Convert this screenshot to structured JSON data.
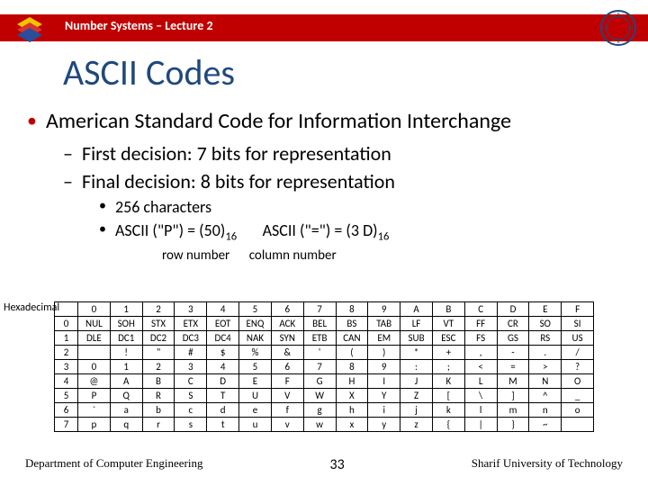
{
  "header": {
    "lecture_title": "Number Systems – Lecture 2"
  },
  "slide": {
    "title": "ASCII Codes"
  },
  "bullets": {
    "b1": "American Standard Code for Information Interchange",
    "b1_1": "First  decision: 7 bits for representation",
    "b1_2": "Final decision: 8 bits for representation",
    "b1_2_1": "256 characters",
    "b1_2_2_a": "ASCII (\"P\") = (50)",
    "b1_2_2_b": "ASCII (\"=\") = (3 D)",
    "sub16": "16",
    "cap_row": "row number",
    "cap_col": "column number"
  },
  "table": {
    "label": "Hexadecimal",
    "col_headers": [
      "0",
      "1",
      "2",
      "3",
      "4",
      "5",
      "6",
      "7",
      "8",
      "9",
      "A",
      "B",
      "C",
      "D",
      "E",
      "F"
    ],
    "row_headers": [
      "0",
      "1",
      "2",
      "3",
      "4",
      "5",
      "6",
      "7"
    ],
    "rows": [
      [
        "NUL",
        "SOH",
        "STX",
        "ETX",
        "EOT",
        "ENQ",
        "ACK",
        "BEL",
        "BS",
        "TAB",
        "LF",
        "VT",
        "FF",
        "CR",
        "SO",
        "SI"
      ],
      [
        "DLE",
        "DC1",
        "DC2",
        "DC3",
        "DC4",
        "NAK",
        "SYN",
        "ETB",
        "CAN",
        "EM",
        "SUB",
        "ESC",
        "FS",
        "GS",
        "RS",
        "US"
      ],
      [
        "",
        "!",
        "\"",
        "#",
        "$",
        "%",
        "&",
        "'",
        "(",
        ")",
        "*",
        "+",
        ",",
        "-",
        ".",
        "/"
      ],
      [
        "0",
        "1",
        "2",
        "3",
        "4",
        "5",
        "6",
        "7",
        "8",
        "9",
        ":",
        ";",
        "<",
        "=",
        ">",
        "?"
      ],
      [
        "@",
        "A",
        "B",
        "C",
        "D",
        "E",
        "F",
        "G",
        "H",
        "I",
        "J",
        "K",
        "L",
        "M",
        "N",
        "O"
      ],
      [
        "P",
        "Q",
        "R",
        "S",
        "T",
        "U",
        "V",
        "W",
        "X",
        "Y",
        "Z",
        "[",
        "\\",
        "]",
        "^",
        "_"
      ],
      [
        "`",
        "a",
        "b",
        "c",
        "d",
        "e",
        "f",
        "g",
        "h",
        "i",
        "j",
        "k",
        "l",
        "m",
        "n",
        "o"
      ],
      [
        "p",
        "q",
        "r",
        "s",
        "t",
        "u",
        "v",
        "w",
        "x",
        "y",
        "z",
        "{",
        "|",
        "}",
        "~",
        ""
      ]
    ]
  },
  "footer": {
    "department": "Department of Computer Engineering",
    "page": "33",
    "university": "Sharif University of Technology"
  }
}
